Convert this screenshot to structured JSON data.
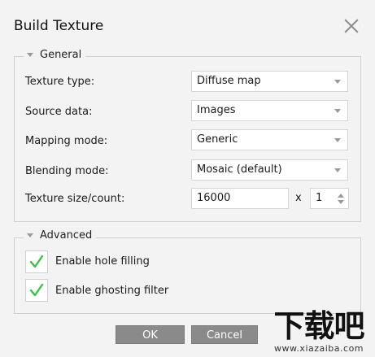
{
  "dialog": {
    "title": "Build Texture",
    "close_icon": "close-icon"
  },
  "general": {
    "legend": "General",
    "rows": [
      {
        "label": "Texture type:",
        "value": "Diffuse map"
      },
      {
        "label": "Source data:",
        "value": "Images"
      },
      {
        "label": "Mapping mode:",
        "value": "Generic"
      },
      {
        "label": "Blending mode:",
        "value": "Mosaic (default)"
      }
    ],
    "texture_size": {
      "label": "Texture size/count:",
      "size_value": "16000",
      "times": "x",
      "count_value": "1"
    }
  },
  "advanced": {
    "legend": "Advanced",
    "options": [
      {
        "label": "Enable hole filling",
        "checked": true
      },
      {
        "label": "Enable ghosting filter",
        "checked": true
      }
    ]
  },
  "buttons": {
    "ok": "OK",
    "cancel": "Cancel"
  },
  "watermark": {
    "logo_text": "下载吧",
    "url": "www.xiazaiba.com"
  },
  "colors": {
    "checkmark": "#3cc24a",
    "button_bg": "#8a8a8a",
    "dialog_bg": "#f3f3f3"
  }
}
